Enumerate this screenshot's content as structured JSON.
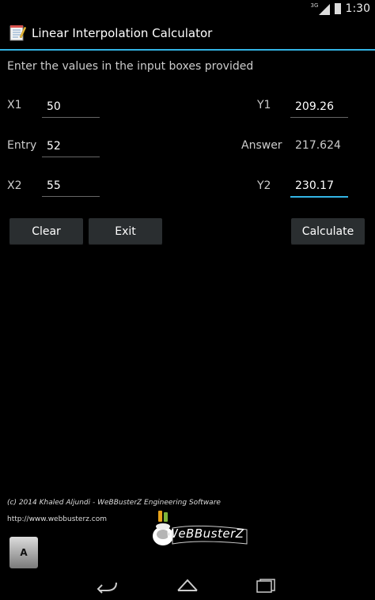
{
  "status_bar": {
    "network": "3G",
    "time": "1:30"
  },
  "app": {
    "title": "Linear Interpolation Calculator"
  },
  "instructions": "Enter the values in the input boxes provided",
  "form": {
    "x1": {
      "label": "X1",
      "value": "50"
    },
    "entry": {
      "label": "Entry",
      "value": "52"
    },
    "x2": {
      "label": "X2",
      "value": "55"
    },
    "y1": {
      "label": "Y1",
      "value": "209.26"
    },
    "answer": {
      "label": "Answer",
      "value": "217.624"
    },
    "y2": {
      "label": "Y2",
      "value": "230.17"
    }
  },
  "buttons": {
    "clear": "Clear",
    "exit": "Exit",
    "calculate": "Calculate"
  },
  "footer": {
    "copyright": "(c) 2014 Khaled Aljundi - WeBBusterZ Engineering Software",
    "website": "http://www.webbusterz.com",
    "logo_text": "WeBBusterZ",
    "a_button": "A"
  },
  "colors": {
    "accent": "#33b5e5",
    "button_bg": "#2a2e30",
    "background": "#000000"
  }
}
